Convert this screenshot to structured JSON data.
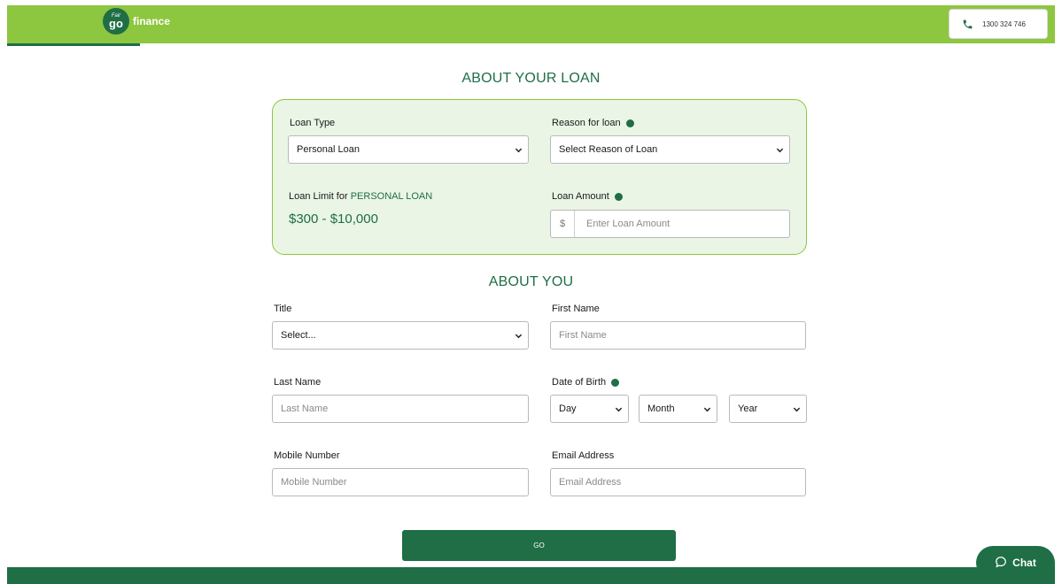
{
  "brand": {
    "logo_fair": "Fair",
    "logo_go": "go",
    "logo_text": "finance",
    "primary_color": "#8dc63f",
    "dark_color": "#1f6e46"
  },
  "header": {
    "phone_icon": "phone-icon",
    "phone_number": "1300 324 746"
  },
  "loan_section": {
    "title": "ABOUT YOUR LOAN",
    "loan_type_label": "Loan Type",
    "loan_type_value": "Personal Loan",
    "reason_label": "Reason for loan",
    "reason_value": "Select Reason of Loan",
    "limit_label_prefix": "Loan Limit for ",
    "limit_label_highlight": "PERSONAL LOAN",
    "limit_value": "$300 - $10,000",
    "amount_label": "Loan Amount",
    "amount_prefix": "$",
    "amount_placeholder": "Enter Loan Amount"
  },
  "about_section": {
    "title": "ABOUT YOU",
    "title_label": "Title",
    "title_value": "Select...",
    "first_name_label": "First Name",
    "first_name_placeholder": "First Name",
    "last_name_label": "Last Name",
    "last_name_placeholder": "Last Name",
    "dob_label": "Date of Birth",
    "dob_day": "Day",
    "dob_month": "Month",
    "dob_year": "Year",
    "mobile_label": "Mobile Number",
    "mobile_placeholder": "Mobile Number",
    "email_label": "Email Address",
    "email_placeholder": "Email Address"
  },
  "actions": {
    "go_label": "GO",
    "chat_label": "Chat"
  }
}
